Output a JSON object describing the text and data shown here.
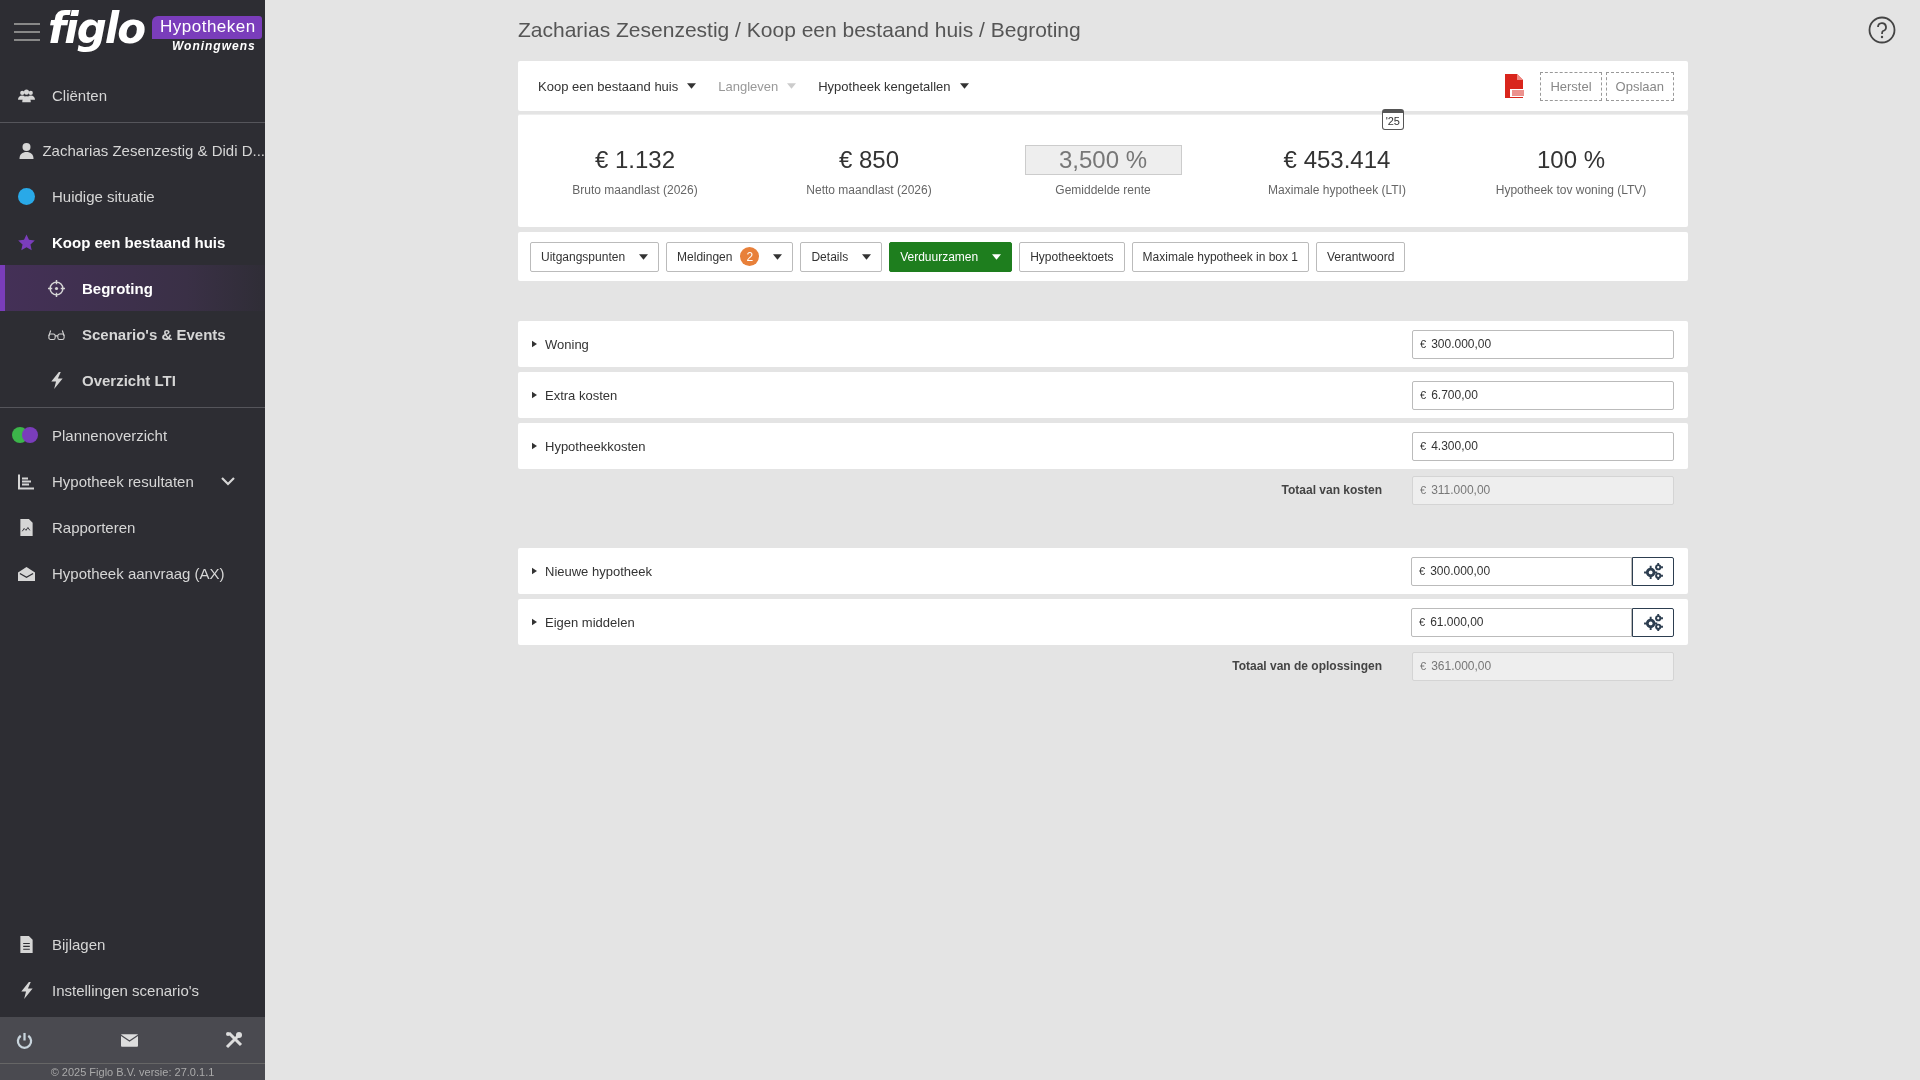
{
  "sidebar": {
    "logo": {
      "wordmark": "figlo",
      "product": "Hypotheken",
      "subtitle": "Woningwens"
    },
    "sections": [
      [
        {
          "label": "Cliënten",
          "selected": false
        }
      ],
      [
        {
          "label": "Zacharias Zesenzestig & Didi D...",
          "selected": false
        },
        {
          "label": "Huidige situatie",
          "selected": false
        },
        {
          "label": "Koop een bestaand huis",
          "selected": false,
          "expanded": true,
          "children": [
            {
              "label": "Begroting",
              "selected": true
            },
            {
              "label": "Scenario's & Events",
              "selected": false
            },
            {
              "label": "Overzicht LTI",
              "selected": false
            }
          ]
        }
      ],
      [
        {
          "label": "Plannenoverzicht",
          "selected": false
        },
        {
          "label": "Hypotheek resultaten",
          "selected": false,
          "expanded": false
        },
        {
          "label": "Rapporteren",
          "selected": false
        },
        {
          "label": "Hypotheek aanvraag (AX)",
          "selected": false
        }
      ]
    ],
    "bottom_items": [
      {
        "label": "Bijlagen",
        "selected": false
      },
      {
        "label": "Instellingen scenario's",
        "selected": false
      }
    ],
    "copyright": "© 2025 Figlo B.V. versie: 27.0.1.1"
  },
  "breadcrumb": "Zacharias Zesenzestig / Koop een bestaand huis / Begroting",
  "toolbar": {
    "menus": [
      {
        "label": "Koop een bestaand huis",
        "disabled": false
      },
      {
        "label": "Langleven",
        "disabled": true
      },
      {
        "label": "Hypotheek kengetallen",
        "disabled": false
      }
    ],
    "buttons": [
      {
        "label": "Herstel",
        "disabled": true
      },
      {
        "label": "Opslaan",
        "disabled": true
      }
    ]
  },
  "stats": [
    {
      "kind": "plain",
      "value": "€ 1.132",
      "label": "Bruto maandlast (2026)"
    },
    {
      "kind": "plain",
      "value": "€ 850",
      "label": "Netto maandlast (2026)"
    },
    {
      "kind": "field",
      "value": "3,500 %",
      "label": "Gemiddelde rente"
    },
    {
      "kind": "plain",
      "value": "€ 453.414",
      "label": "Maximale hypotheek (LTI)",
      "badge": "'25"
    },
    {
      "kind": "plain",
      "value": "100 %",
      "label": "Hypotheek tov woning (LTV)"
    }
  ],
  "actions": [
    {
      "kind": "dropdown",
      "label": "Uitgangspunten",
      "primary": false
    },
    {
      "kind": "dropdown",
      "label": "Meldingen",
      "badge": "2",
      "primary": false
    },
    {
      "kind": "dropdown",
      "label": "Details",
      "primary": false
    },
    {
      "kind": "dropdown",
      "label": "Verduurzamen",
      "primary": true
    },
    {
      "kind": "button",
      "label": "Hypotheektoets",
      "primary": false
    },
    {
      "kind": "button",
      "label": "Maximale hypotheek in box 1",
      "primary": false
    },
    {
      "kind": "button",
      "label": "Verantwoord",
      "primary": false
    }
  ],
  "costs": {
    "rows": [
      {
        "label": "Woning",
        "value": "300.000,00",
        "expanded": false
      },
      {
        "label": "Extra kosten",
        "value": "6.700,00",
        "expanded": false
      },
      {
        "label": "Hypotheekkosten",
        "value": "4.300,00",
        "expanded": false
      }
    ],
    "total": {
      "label": "Totaal van kosten",
      "value": "311.000,00"
    }
  },
  "solutions": {
    "rows": [
      {
        "label": "Nieuwe hypotheek",
        "value": "300.000,00",
        "expanded": false
      },
      {
        "label": "Eigen middelen",
        "value": "61.000,00",
        "expanded": false
      }
    ],
    "total": {
      "label": "Totaal van de oplossingen",
      "value": "361.000,00"
    }
  },
  "currency": "€"
}
